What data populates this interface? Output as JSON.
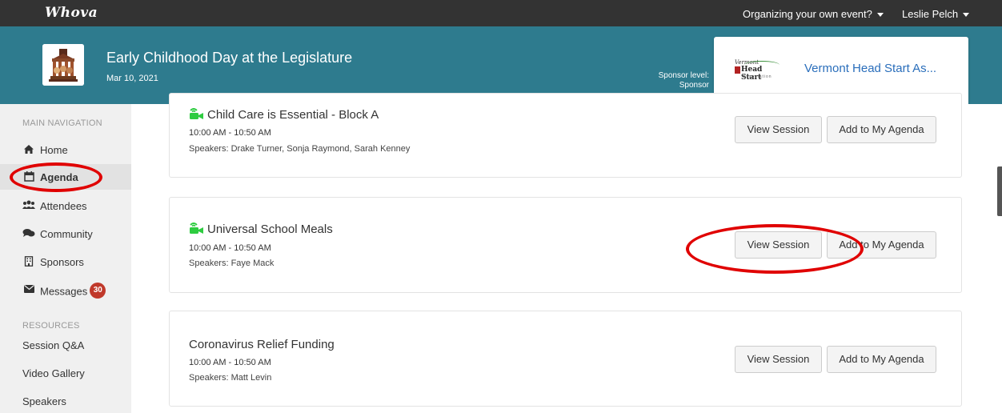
{
  "topbar": {
    "brand": "Whova",
    "organize_menu": "Organizing your own event?",
    "user_menu": "Leslie Pelch"
  },
  "event": {
    "title": "Early Childhood Day at the Legislature",
    "date": "Mar 10, 2021"
  },
  "sponsor": {
    "level_label": "Sponsor level:",
    "level_value": "Sponsor",
    "logo_top": "Vermont",
    "logo_main": "Head Start",
    "logo_sub": "Association",
    "name": "Vermont Head Start As..."
  },
  "sidebar": {
    "main_heading": "MAIN NAVIGATION",
    "items": [
      {
        "label": "Home",
        "icon": "home-icon"
      },
      {
        "label": "Agenda",
        "icon": "calendar-icon",
        "active": true
      },
      {
        "label": "Attendees",
        "icon": "users-icon"
      },
      {
        "label": "Community",
        "icon": "chat-icon"
      },
      {
        "label": "Sponsors",
        "icon": "building-icon"
      },
      {
        "label": "Messages",
        "icon": "envelope-icon",
        "badge": "30"
      }
    ],
    "resources_heading": "RESOURCES",
    "resources": [
      {
        "label": "Session Q&A"
      },
      {
        "label": "Video Gallery"
      },
      {
        "label": "Speakers"
      }
    ]
  },
  "buttons": {
    "view_session": "View Session",
    "add_agenda": "Add to My Agenda"
  },
  "sessions": [
    {
      "title": "Child Care is Essential - Block A",
      "time": "10:00 AM - 10:50 AM",
      "speakers": "Speakers: Drake Turner, Sonja Raymond, Sarah Kenney",
      "has_video": true
    },
    {
      "title": "Universal School Meals",
      "time": "10:00 AM - 10:50 AM",
      "speakers": "Speakers: Faye Mack",
      "has_video": true
    },
    {
      "title": "Coronavirus Relief Funding",
      "time": "10:00 AM - 10:50 AM",
      "speakers": "Speakers: Matt Levin",
      "has_video": false
    }
  ],
  "colors": {
    "topbar": "#333333",
    "header": "#2e7b8e",
    "link": "#2a6ebb",
    "badge": "#c0392b",
    "video_icon": "#2ecc40",
    "annotation": "#e00000"
  }
}
